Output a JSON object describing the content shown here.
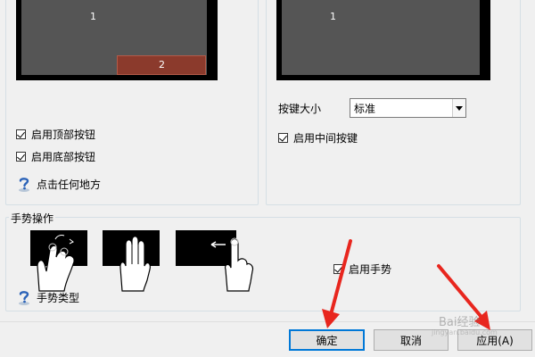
{
  "left_panel": {
    "preview": {
      "top_zone_number": "1",
      "bottom_zone_number": "2"
    },
    "options": [
      {
        "label": "启用顶部按钮",
        "checked": true
      },
      {
        "label": "启用底部按钮",
        "checked": true
      }
    ],
    "help_label": "点击任何地方"
  },
  "right_panel": {
    "preview": {
      "zone_number": "1"
    },
    "button_size": {
      "label": "按键大小",
      "value": "标准"
    },
    "middle_button": {
      "label": "启用中间按键",
      "checked": true
    }
  },
  "gestures": {
    "title": "手势操作",
    "enable": {
      "label": "启用手势",
      "checked": true
    },
    "help_label": "手势类型"
  },
  "dialog_buttons": {
    "ok": "确定",
    "cancel": "取消",
    "apply": "应用(A)"
  },
  "watermark": {
    "text": "Bai经验",
    "sub": "jingyan.baidu.com"
  },
  "colors": {
    "bottom_zone": "#8b3a2c",
    "preview_frame": "#000000",
    "preview_screen": "#555555",
    "arrow_red": "#e8261e",
    "default_button_border": "#0078d7"
  }
}
